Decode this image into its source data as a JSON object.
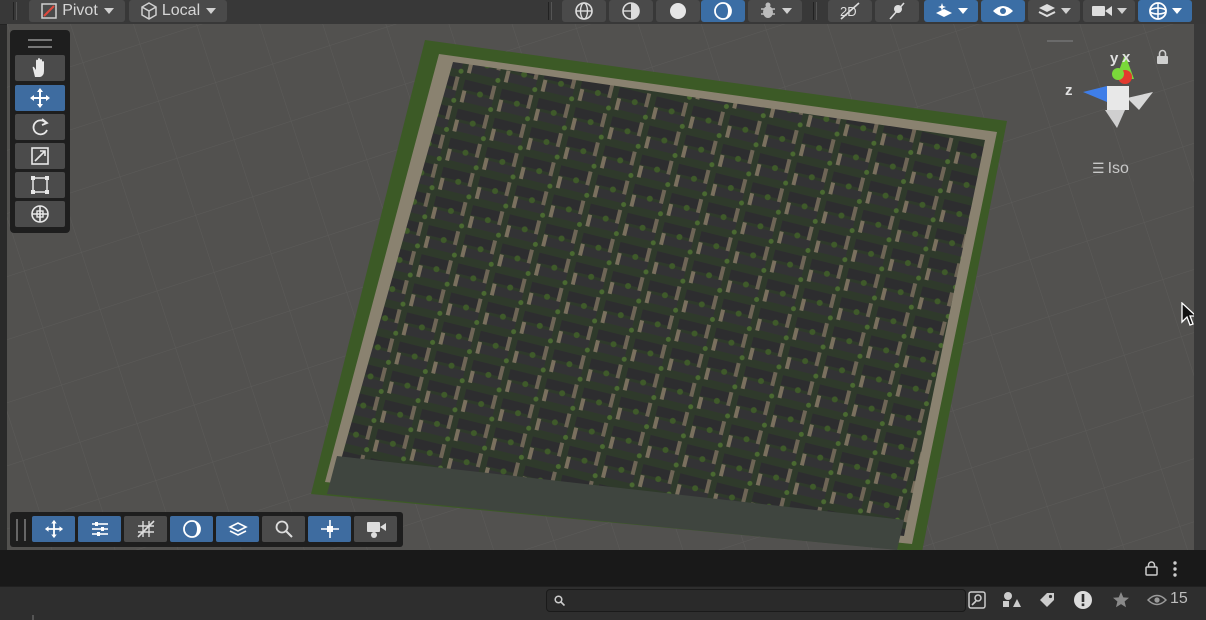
{
  "toolbar": {
    "pivot_label": "Pivot",
    "local_label": "Local"
  },
  "gizmo": {
    "x_label": "x",
    "y_label": "y",
    "z_label": "z",
    "projection_label": "Iso"
  },
  "status": {
    "search_placeholder": "",
    "visible_count": "15"
  },
  "colors": {
    "accent": "#3e6ca0",
    "scene_background": "#52514f",
    "gizmo_x": "#e23a2e",
    "gizmo_y": "#7ad83a",
    "gizmo_z": "#3f7ee8"
  }
}
